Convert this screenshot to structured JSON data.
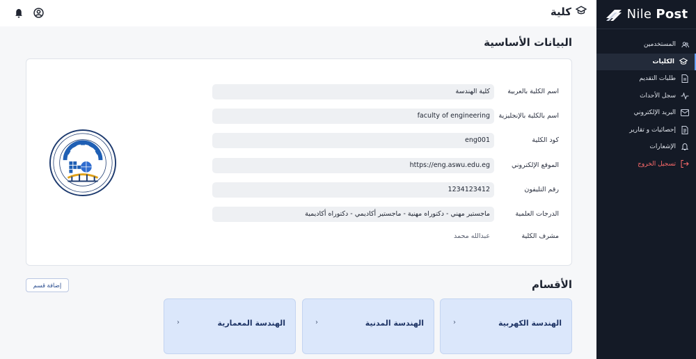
{
  "brand": {
    "part1": "Nile",
    "part2": "Post"
  },
  "sidebar": {
    "items": [
      {
        "label": "المستخدمين",
        "icon": "users-icon"
      },
      {
        "label": "الكليات",
        "icon": "graduation-cap-icon",
        "active": true
      },
      {
        "label": "طلبات التقديم",
        "icon": "document-icon"
      },
      {
        "label": "سجل الأحداث",
        "icon": "activity-icon"
      },
      {
        "label": "البريد الإلكتروني",
        "icon": "mail-icon"
      },
      {
        "label": "إحصائيات و تقارير",
        "icon": "report-icon"
      },
      {
        "label": "الإشعارات",
        "icon": "bell-icon"
      },
      {
        "label": "تسجيل الخروج",
        "icon": "logout-icon",
        "danger": true
      }
    ]
  },
  "header": {
    "title": "كلية"
  },
  "basic_info": {
    "title": "البيانات الأساسية",
    "fields": [
      {
        "label": "اسم الكلية بالعربية",
        "value": "كلية الهندسة"
      },
      {
        "label": "اسم بالكلية بالإنجليزية",
        "value": "faculty of engineering"
      },
      {
        "label": "كود الكلية",
        "value": "eng001"
      },
      {
        "label": "الموقع الإلكتروني",
        "value": "https://eng.aswu.edu.eg"
      },
      {
        "label": "رقم التليفون",
        "value": "1234123412"
      },
      {
        "label": "الدرجات العلمية",
        "value": "ماجستير مهني - دكتوراه مهنية - ماجستير أكاديمي - دكتوراه أكاديمية"
      },
      {
        "label": "مشرف الكلية",
        "value": "عبدالله محمد"
      }
    ]
  },
  "departments": {
    "title": "الأقسام",
    "add_label": "إضافة قسم",
    "items": [
      {
        "name": "الهندسة الكهربية"
      },
      {
        "name": "الهندسة المدنية"
      },
      {
        "name": "الهندسة المعمارية"
      }
    ]
  },
  "colors": {
    "sidebar_bg": "#141a26",
    "accent": "#6aa2ff",
    "danger": "#ff6b6b",
    "dept_card": "#dbe7fb"
  }
}
